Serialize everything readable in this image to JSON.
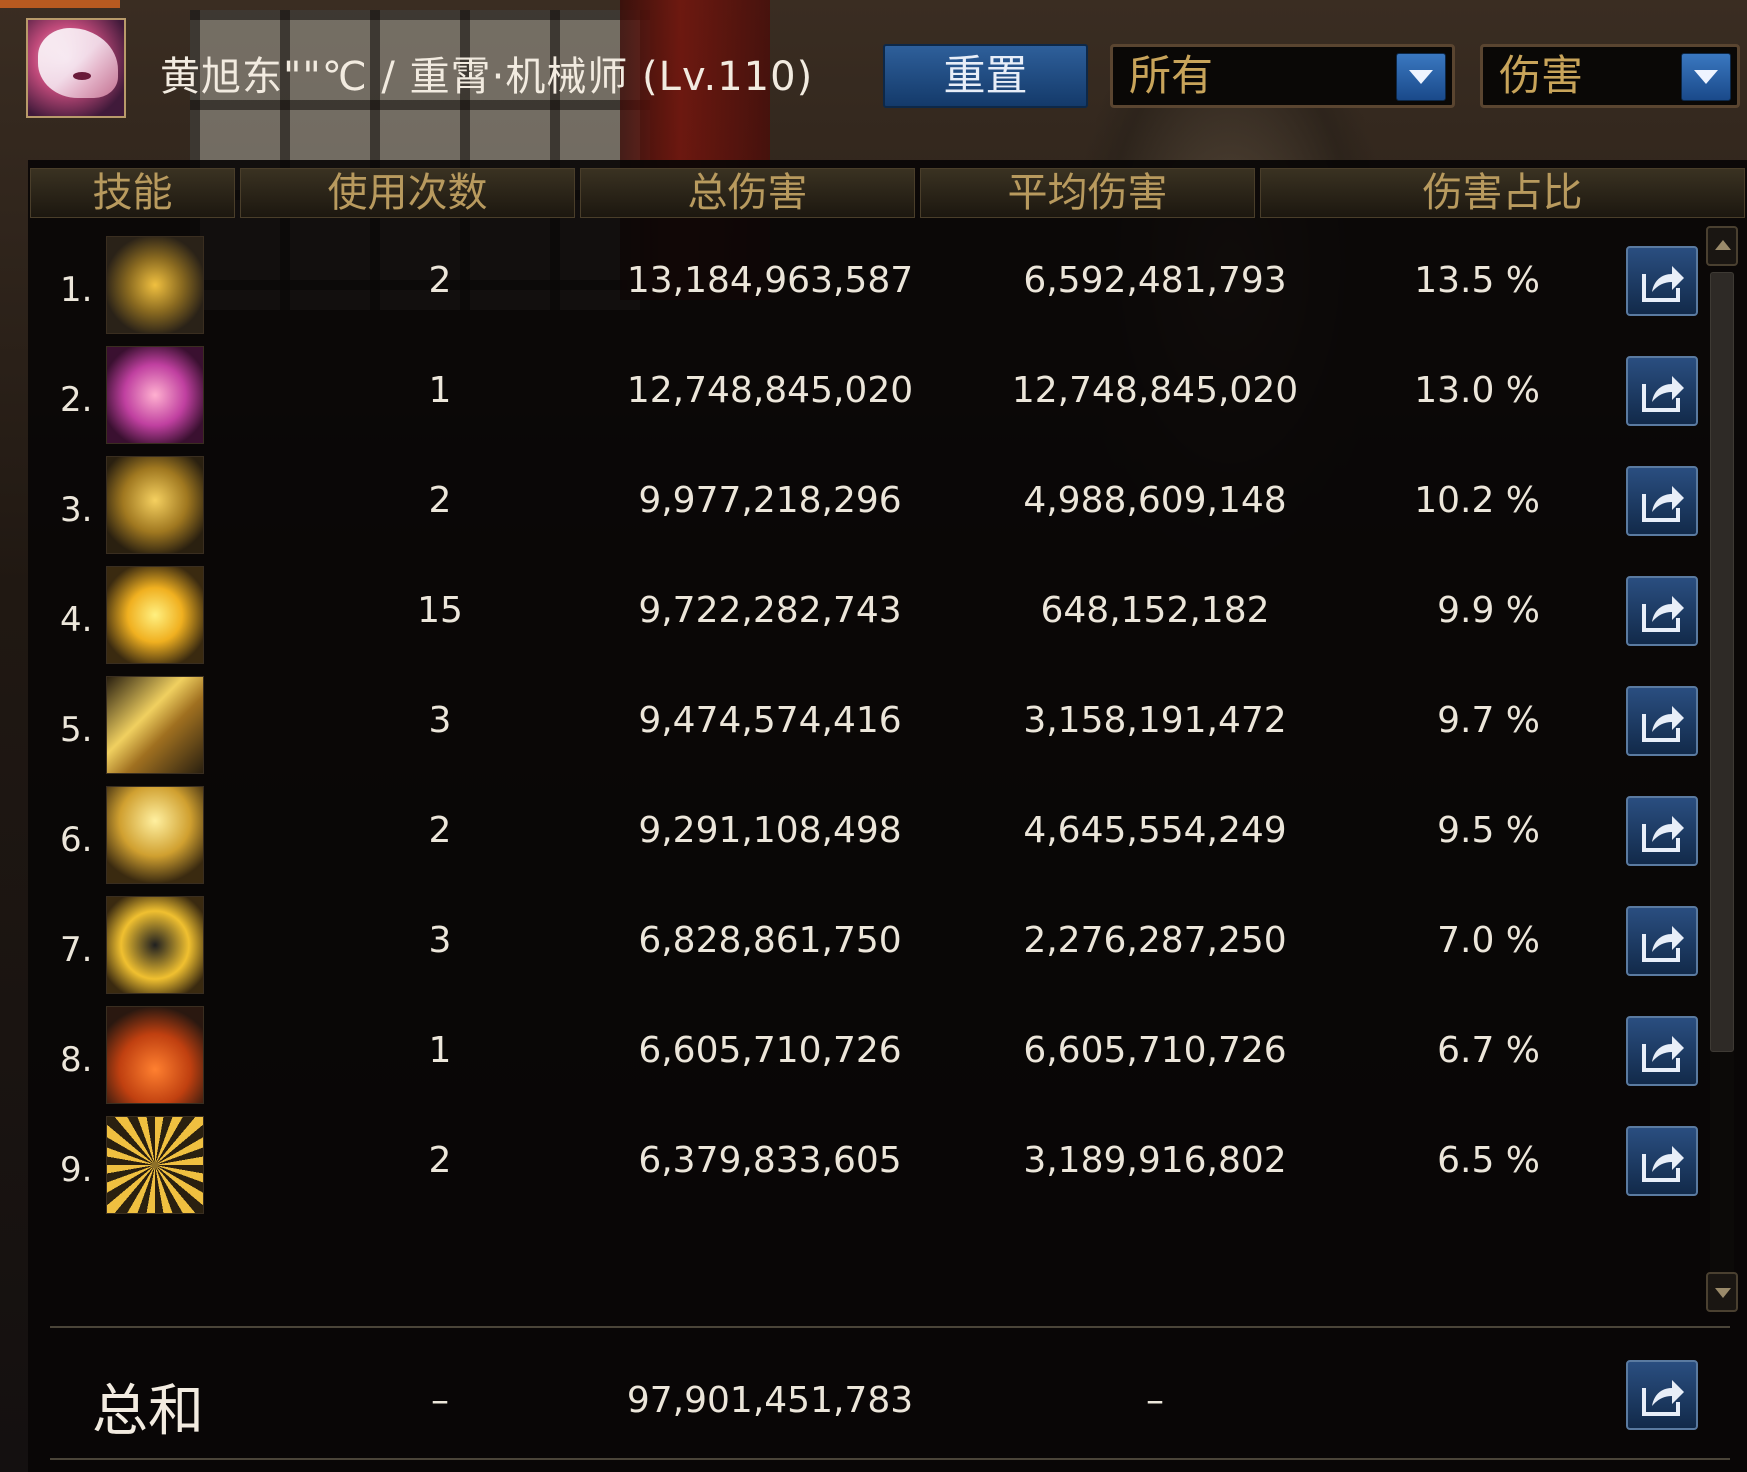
{
  "header": {
    "character": "黄旭东\"\"℃ / 重霄·机械师 (Lv.110)",
    "reset_label": "重置",
    "filter_value": "所有",
    "type_value": "伤害"
  },
  "columns": [
    "技能",
    "使用次数",
    "总伤害",
    "平均伤害",
    "伤害占比"
  ],
  "rows": [
    {
      "rank": "1.",
      "icon": "skill-1-icon",
      "uses": "2",
      "total": "13,184,963,587",
      "avg": "6,592,481,793",
      "pct": "13.5 %"
    },
    {
      "rank": "2.",
      "icon": "skill-2-icon",
      "uses": "1",
      "total": "12,748,845,020",
      "avg": "12,748,845,020",
      "pct": "13.0 %"
    },
    {
      "rank": "3.",
      "icon": "skill-3-icon",
      "uses": "2",
      "total": "9,977,218,296",
      "avg": "4,988,609,148",
      "pct": "10.2 %"
    },
    {
      "rank": "4.",
      "icon": "skill-4-icon",
      "uses": "15",
      "total": "9,722,282,743",
      "avg": "648,152,182",
      "pct": "9.9 %"
    },
    {
      "rank": "5.",
      "icon": "skill-5-icon",
      "uses": "3",
      "total": "9,474,574,416",
      "avg": "3,158,191,472",
      "pct": "9.7 %"
    },
    {
      "rank": "6.",
      "icon": "skill-6-icon",
      "uses": "2",
      "total": "9,291,108,498",
      "avg": "4,645,554,249",
      "pct": "9.5 %"
    },
    {
      "rank": "7.",
      "icon": "skill-7-icon",
      "uses": "3",
      "total": "6,828,861,750",
      "avg": "2,276,287,250",
      "pct": "7.0 %"
    },
    {
      "rank": "8.",
      "icon": "skill-8-icon",
      "uses": "1",
      "total": "6,605,710,726",
      "avg": "6,605,710,726",
      "pct": "6.7 %"
    },
    {
      "rank": "9.",
      "icon": "skill-9-icon",
      "uses": "2",
      "total": "6,379,833,605",
      "avg": "3,189,916,802",
      "pct": "6.5 %"
    }
  ],
  "summary": {
    "label": "总和",
    "uses": "–",
    "total": "97,901,451,783",
    "avg": "–"
  },
  "colors": {
    "header_gold": "#b89a5e",
    "button_blue": "#2e5f9a",
    "panel_bg": "#0a0806"
  }
}
